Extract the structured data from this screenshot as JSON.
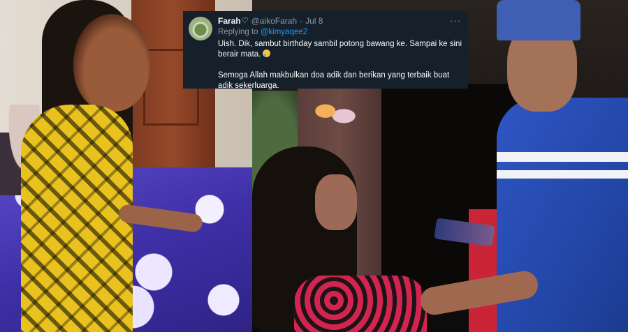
{
  "tweet": {
    "display_name": "Farah",
    "name_icon": "heart-outline-icon",
    "handle": "@aikoFarah",
    "separator": "·",
    "date": "Jul 8",
    "more_icon": "ellipsis-icon",
    "reply_prefix": "Replying to",
    "reply_to": "@kimyaqee2",
    "text_line1": "Uish. Dik, sambut birthday sambil potong bawang ke. Sampai ke sini berair mata.",
    "text_emoji": "crying-face-emoji",
    "text_line2": "Semoga Allah makbulkan doa adik dan berikan yang terbaik buat adik sekerluarga."
  },
  "colors": {
    "tweet_bg": "#15202b",
    "link": "#1d9bf0",
    "muted": "#8b98a5"
  }
}
